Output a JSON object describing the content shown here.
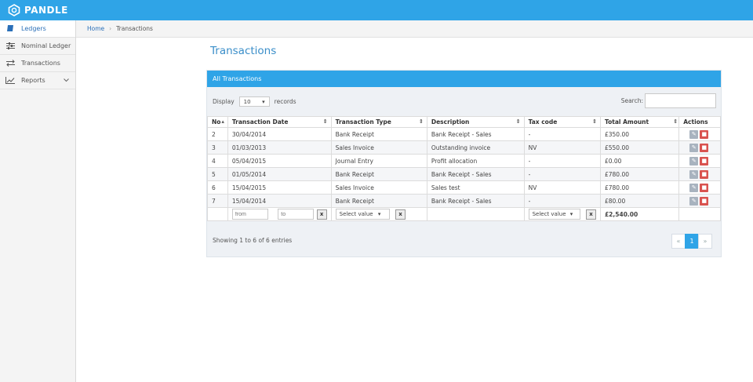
{
  "app": {
    "name": "PANDLE"
  },
  "sidebar": {
    "items": [
      {
        "label": "Ledgers",
        "icon": "book-icon",
        "active": true
      },
      {
        "label": "Nominal Ledger",
        "icon": "sliders-icon"
      },
      {
        "label": "Transactions",
        "icon": "exchange-icon"
      },
      {
        "label": "Reports",
        "icon": "chart-line-icon",
        "has_submenu": true
      }
    ]
  },
  "breadcrumb": {
    "home": "Home",
    "separator": "›",
    "current": "Transactions"
  },
  "page": {
    "title": "Transactions"
  },
  "panel": {
    "title": "All Transactions",
    "display_label": "Display",
    "display_value": "10",
    "records_label": "records",
    "search_label": "Search:",
    "search_value": ""
  },
  "table": {
    "headers": {
      "no": "No",
      "date": "Transaction Date",
      "type": "Transaction Type",
      "description": "Description",
      "tax": "Tax code",
      "total": "Total Amount",
      "actions": "Actions"
    },
    "rows": [
      {
        "no": "2",
        "date": "30/04/2014",
        "type": "Bank Receipt",
        "description": "Bank Receipt - Sales",
        "tax": "-",
        "total": "£350.00"
      },
      {
        "no": "3",
        "date": "01/03/2013",
        "type": "Sales Invoice",
        "description": "Outstanding invoice",
        "tax": "NV",
        "total": "£550.00"
      },
      {
        "no": "4",
        "date": "05/04/2015",
        "type": "Journal Entry",
        "description": "Profit allocation",
        "tax": "-",
        "total": "£0.00"
      },
      {
        "no": "5",
        "date": "01/05/2014",
        "type": "Bank Receipt",
        "description": "Bank Receipt - Sales",
        "tax": "-",
        "total": "£780.00"
      },
      {
        "no": "6",
        "date": "15/04/2015",
        "type": "Sales Invoice",
        "description": "Sales test",
        "tax": "NV",
        "total": "£780.00"
      },
      {
        "no": "7",
        "date": "15/04/2014",
        "type": "Bank Receipt",
        "description": "Bank Receipt - Sales",
        "tax": "-",
        "total": "£80.00"
      }
    ],
    "filters": {
      "from_placeholder": "from",
      "to_placeholder": "to",
      "type_select": "Select value",
      "tax_select": "Select value",
      "clear_label": "x",
      "grand_total": "£2,540.00"
    }
  },
  "footer": {
    "info": "Showing 1 to 6 of 6 entries",
    "pager": {
      "prev": "«",
      "current": "1",
      "next": "»"
    }
  },
  "colors": {
    "brand": "#2fa4e7",
    "delete": "#d9534f",
    "link": "#3a8ec9"
  }
}
